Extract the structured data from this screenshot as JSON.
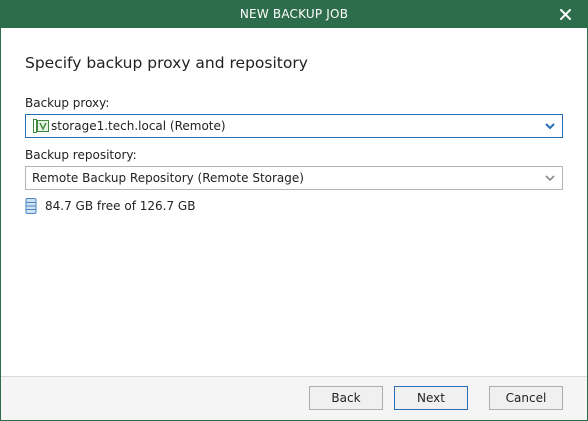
{
  "window": {
    "title": "NEW BACKUP JOB"
  },
  "page": {
    "heading": "Specify backup proxy and repository"
  },
  "proxy": {
    "label": "Backup proxy:",
    "selected": "storage1.tech.local (Remote)",
    "icon": "proxy-server-icon"
  },
  "repository": {
    "label": "Backup repository:",
    "selected": "Remote Backup Repository (Remote Storage)",
    "free_space": "84.7 GB free of 126.7 GB",
    "icon": "storage-icon"
  },
  "buttons": {
    "back": "Back",
    "next": "Next",
    "cancel": "Cancel"
  },
  "colors": {
    "titlebar": "#2e6d4b",
    "focus": "#2a6fb3"
  }
}
